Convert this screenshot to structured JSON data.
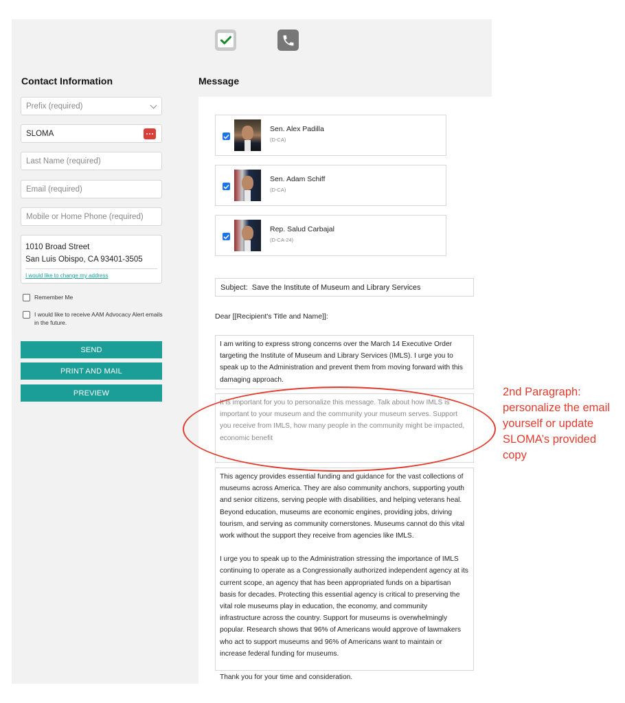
{
  "contact": {
    "title": "Contact Information",
    "prefix_placeholder": "Prefix (required)",
    "first_name_value": "SLOMA",
    "last_name_placeholder": "Last Name (required)",
    "email_placeholder": "Email (required)",
    "phone_placeholder": "Mobile or Home Phone (required)",
    "address": {
      "line1": "1010 Broad Street",
      "line2": "San Luis Obispo, CA 93401-3505",
      "change_link": "I would like to change my address"
    },
    "remember_me": "Remember Me",
    "alerts_optin": "I would like to receive AAM Advocacy Alert emails in the future."
  },
  "buttons": {
    "send": "SEND",
    "print_mail": "PRINT AND MAIL",
    "preview": "PREVIEW"
  },
  "message": {
    "title": "Message",
    "recipients": [
      {
        "name": "Sen. Alex Padilla",
        "party": "(D-CA)",
        "checked": true
      },
      {
        "name": "Sen. Adam Schiff",
        "party": "(D-CA)",
        "checked": true
      },
      {
        "name": "Rep. Salud Carbajal",
        "party": "(D-CA-24)",
        "checked": true
      }
    ],
    "subject_label": "Subject:",
    "subject_value": "Save the Institute of Museum and Library Services",
    "salutation": "Dear [[Recipient's Title and Name]]:",
    "paragraph1": "I am writing to express strong concerns over the March 14 Executive Order targeting the Institute of Museum and Library Services (IMLS). I urge you to speak up to the Administration and prevent them from moving forward with this damaging approach.",
    "paragraph2_placeholder": "It is important for you to personalize this message.  Talk about how IMLS is important to your museum and the community your museum serves.  Support you receive from IMLS, how many people in the community might be impacted, economic benefit",
    "paragraph3": "This agency provides essential funding and guidance for the vast collections of museums across America. They are also community anchors, supporting youth and senior citizens, serving people with disabilities, and helping veterans heal. Beyond education, museums are economic engines, providing jobs, driving tourism, and serving as community cornerstones. Museums cannot do this vital work without the support they receive from agencies like IMLS.",
    "paragraph4": "I urge you to speak up to the Administration stressing the importance of IMLS continuing to operate as a Congressionally authorized independent agency at its current scope, an agency that has been appropriated funds on a bipartisan basis for decades. Protecting this essential agency is critical to preserving the vital role museums play in education, the economy, and community infrastructure across the country. Support for museums is overwhelmingly popular. Research shows that 96% of Americans would approve of lawmakers who act to support museums and 96% of Americans want to maintain or increase federal funding for museums.",
    "paragraph5": "Thank you for your time and consideration."
  },
  "annotation": {
    "text": "2nd Paragraph: personalize the email yourself or update SLOMA’s provided copy"
  },
  "colors": {
    "accent_teal": "#1a9e97",
    "annotation_red": "#e23b2e",
    "checkbox_blue": "#1a73e8"
  },
  "icons": {
    "top_left": "check-icon",
    "top_right": "phone-icon"
  }
}
